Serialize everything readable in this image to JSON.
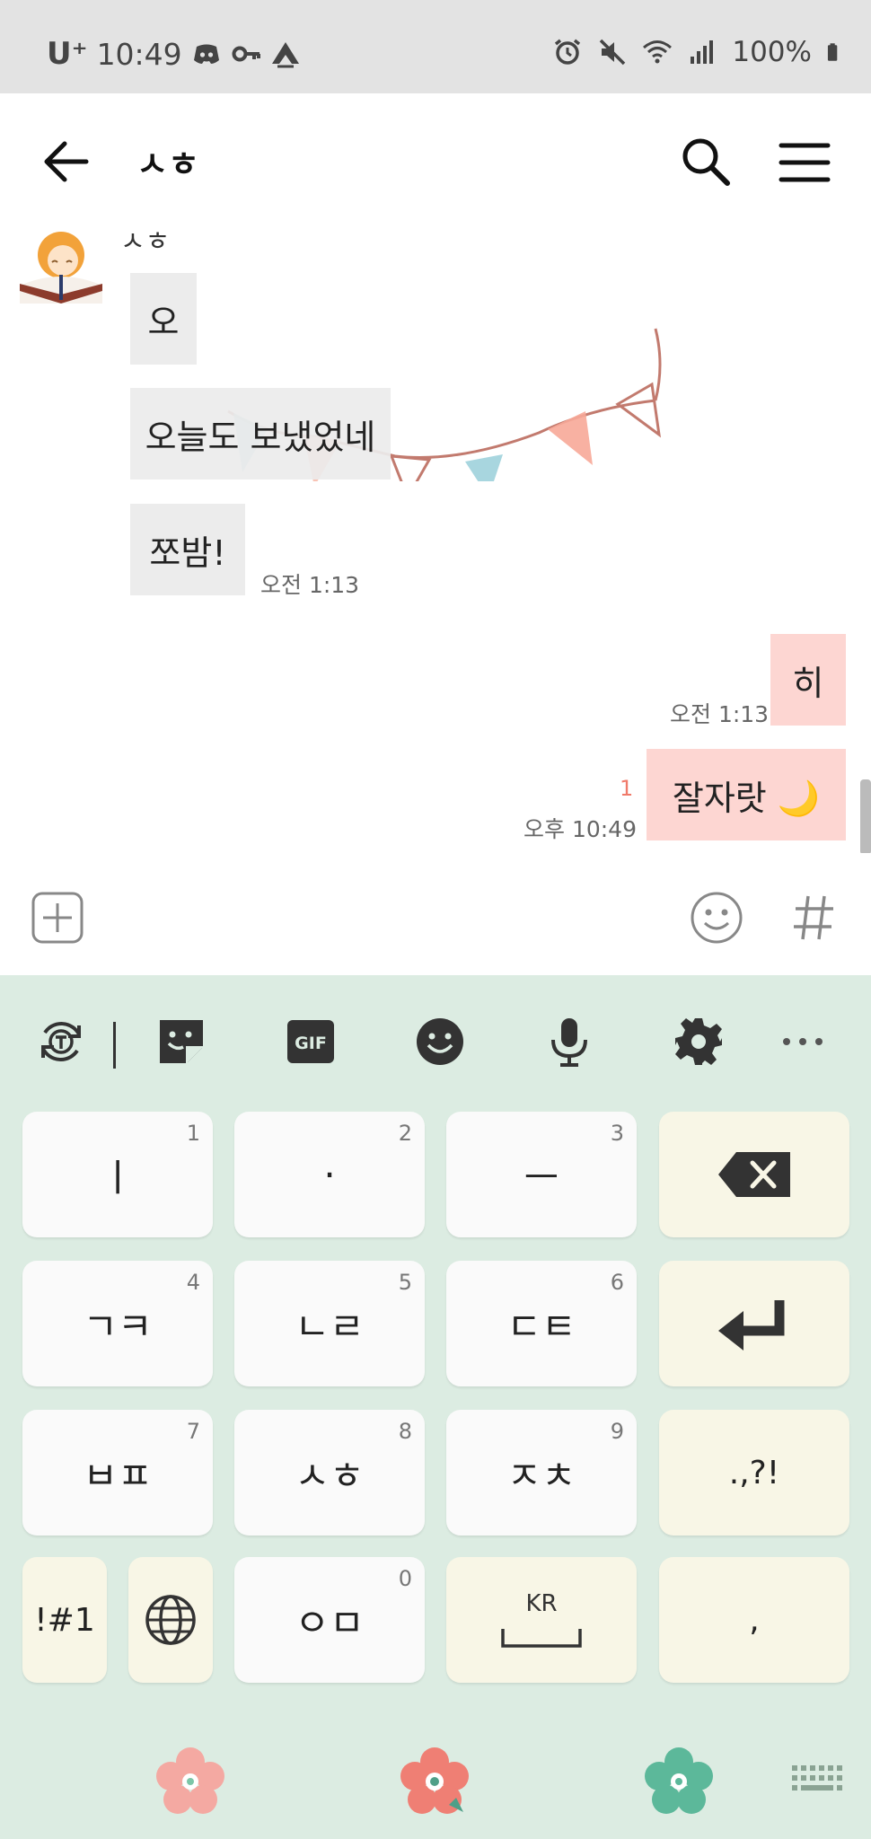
{
  "status_bar": {
    "carrier": "U⁺",
    "time": "10:49",
    "battery": "100%"
  },
  "header": {
    "title": "ㅅㅎ"
  },
  "chat": {
    "sender_name": "ㅅㅎ",
    "incoming": [
      {
        "text": "오"
      },
      {
        "text": "오늘도 보냈었네"
      },
      {
        "text": "쪼밤!"
      }
    ],
    "incoming_time": "오전 1:13",
    "outgoing": [
      {
        "text": "히",
        "time": "오전 1:13"
      },
      {
        "text": "잘자랏 🌙",
        "time": "오후 10:49",
        "unread": "1"
      }
    ]
  },
  "keyboard": {
    "rows": [
      [
        {
          "label": "ㅣ",
          "num": "1"
        },
        {
          "label": "·",
          "num": "2"
        },
        {
          "label": "ㅡ",
          "num": "3"
        }
      ],
      [
        {
          "label": "ㄱㅋ",
          "num": "4"
        },
        {
          "label": "ㄴㄹ",
          "num": "5"
        },
        {
          "label": "ㄷㅌ",
          "num": "6"
        }
      ],
      [
        {
          "label": "ㅂㅍ",
          "num": "7"
        },
        {
          "label": "ㅅㅎ",
          "num": "8"
        },
        {
          "label": "ㅈㅊ",
          "num": "9"
        }
      ]
    ],
    "punct_label": ".,?!",
    "symbols_label": "!#1",
    "om_label": "ㅇㅁ",
    "om_num": "0",
    "space_lang": "KR",
    "comma_label": ","
  }
}
